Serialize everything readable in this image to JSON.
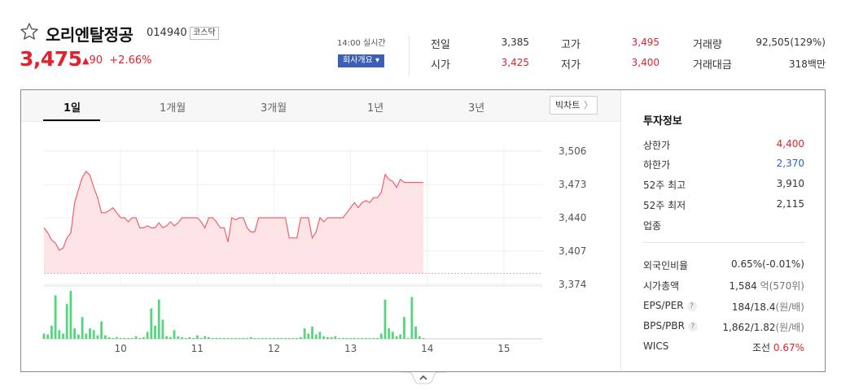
{
  "header": {
    "stock_name": "오리엔탈정공",
    "stock_code": "014940",
    "market_badge": "코스닥",
    "price": "3,475",
    "change_arrow": "▲",
    "change_amount": "90",
    "change_percent": "+2.66%",
    "time_label": "14:00 실시간",
    "company_button": "회사개요 ▾"
  },
  "quotes": {
    "prev_close": {
      "label": "전일",
      "value": "3,385"
    },
    "open": {
      "label": "시가",
      "value": "3,425"
    },
    "high": {
      "label": "고가",
      "value": "3,495"
    },
    "low": {
      "label": "저가",
      "value": "3,400"
    },
    "volume": {
      "label": "거래량",
      "value": "92,505(129%)"
    },
    "turnover": {
      "label": "거래대금",
      "value": "318백만"
    }
  },
  "tabs": [
    "1일",
    "1개월",
    "3개월",
    "1년",
    "3년"
  ],
  "active_tab": "1일",
  "big_chart_button": "빅차트",
  "invest_info": {
    "title": "투자정보",
    "upper_limit": {
      "label": "상한가",
      "value": "4,400"
    },
    "lower_limit": {
      "label": "하한가",
      "value": "2,370"
    },
    "week52_high": {
      "label": "52주 최고",
      "value": "3,910"
    },
    "week52_low": {
      "label": "52주 최저",
      "value": "2,115"
    },
    "sector": {
      "label": "업종",
      "value": ""
    },
    "foreign_ratio": {
      "label": "외국인비율",
      "value": "0.65%",
      "extra": "(-0.01%)"
    },
    "market_cap": {
      "label": "시가총액",
      "value": "1,584",
      "unit1": "억",
      "value2": "(570",
      "unit2": "위)"
    },
    "eps_per": {
      "label": "EPS/PER",
      "value": "184/18.4",
      "unit": "(원/배)"
    },
    "bps_pbr": {
      "label": "BPS/PBR",
      "value": "1,862/1.82",
      "unit": "(원/배)"
    },
    "wics": {
      "label": "WICS",
      "value": "조선",
      "extra": "0.67%"
    },
    "help_icon": "?"
  },
  "colors": {
    "up": "#e0232e",
    "down": "#2d5ddb",
    "line": "#f0606a",
    "area": "#fde4e6",
    "volume_bar": "#55d67c",
    "accent_button": "#3a5fb8"
  },
  "chart_data": {
    "type": "line",
    "y_ticks": [
      "3,506",
      "3,473",
      "3,440",
      "3,407",
      "3,374"
    ],
    "ylim": [
      3374,
      3506
    ],
    "x_ticks": [
      "10",
      "11",
      "12",
      "13",
      "14",
      "15"
    ],
    "xlim": [
      9.0,
      15.5
    ],
    "prev_close": 3385,
    "series": [
      {
        "x": [
          9.0,
          9.05,
          9.1,
          9.15,
          9.2,
          9.25,
          9.3,
          9.35,
          9.4,
          9.45,
          9.5,
          9.55,
          9.6,
          9.65,
          9.7,
          9.75,
          9.8,
          9.85,
          9.9,
          9.95,
          10.0,
          10.05,
          10.1,
          10.15,
          10.2,
          10.25,
          10.3,
          10.35,
          10.4,
          10.45,
          10.5,
          10.55,
          10.6,
          10.65,
          10.7,
          10.75,
          10.8,
          10.85,
          10.9,
          10.95,
          11.0,
          11.05,
          11.1,
          11.15,
          11.2,
          11.25,
          11.3,
          11.35,
          11.4,
          11.45,
          11.5,
          11.55,
          11.6,
          11.65,
          11.7,
          11.75,
          11.8,
          11.85,
          11.9,
          11.95,
          12.0,
          12.05,
          12.1,
          12.15,
          12.2,
          12.25,
          12.3,
          12.35,
          12.4,
          12.45,
          12.5,
          12.55,
          12.6,
          12.65,
          12.7,
          12.75,
          12.8,
          12.85,
          12.9,
          12.95,
          13.0,
          13.05,
          13.1,
          13.15,
          13.2,
          13.25,
          13.3,
          13.35,
          13.4,
          13.45,
          13.5,
          13.55,
          13.6,
          13.65,
          13.7,
          13.75,
          13.8,
          13.85,
          13.9,
          13.95
        ],
        "values": [
          3430,
          3425,
          3418,
          3415,
          3408,
          3410,
          3420,
          3425,
          3455,
          3468,
          3480,
          3486,
          3482,
          3470,
          3460,
          3445,
          3445,
          3447,
          3450,
          3445,
          3440,
          3440,
          3436,
          3440,
          3440,
          3430,
          3430,
          3432,
          3430,
          3430,
          3435,
          3430,
          3432,
          3436,
          3432,
          3435,
          3440,
          3440,
          3440,
          3440,
          3440,
          3436,
          3430,
          3440,
          3440,
          3436,
          3430,
          3430,
          3416,
          3440,
          3438,
          3440,
          3440,
          3430,
          3426,
          3426,
          3440,
          3440,
          3440,
          3440,
          3440,
          3440,
          3440,
          3440,
          3420,
          3420,
          3420,
          3440,
          3440,
          3440,
          3420,
          3426,
          3440,
          3436,
          3440,
          3440,
          3440,
          3440,
          3440,
          3445,
          3450,
          3455,
          3450,
          3455,
          3457,
          3455,
          3460,
          3460,
          3465,
          3483,
          3478,
          3476,
          3470,
          3478,
          3475,
          3475,
          3475,
          3475,
          3475,
          3475
        ]
      }
    ],
    "volume": {
      "x": [
        9.0,
        9.05,
        9.1,
        9.15,
        9.2,
        9.25,
        9.3,
        9.35,
        9.4,
        9.45,
        9.5,
        9.55,
        9.6,
        9.65,
        9.7,
        9.75,
        9.8,
        9.85,
        9.9,
        9.95,
        10.0,
        10.05,
        10.1,
        10.15,
        10.2,
        10.25,
        10.3,
        10.35,
        10.4,
        10.45,
        10.5,
        10.55,
        10.6,
        10.65,
        10.7,
        10.75,
        10.8,
        10.85,
        10.9,
        10.95,
        11.0,
        11.05,
        11.1,
        11.15,
        11.2,
        11.25,
        11.3,
        11.35,
        11.4,
        11.45,
        11.5,
        11.55,
        11.6,
        11.65,
        11.7,
        11.75,
        11.8,
        11.85,
        11.9,
        11.95,
        12.0,
        12.05,
        12.1,
        12.15,
        12.2,
        12.25,
        12.3,
        12.35,
        12.4,
        12.45,
        12.5,
        12.55,
        12.6,
        12.65,
        12.7,
        12.75,
        12.8,
        12.85,
        12.9,
        12.95,
        13.0,
        13.05,
        13.1,
        13.15,
        13.2,
        13.25,
        13.3,
        13.35,
        13.4,
        13.45,
        13.5,
        13.55,
        13.6,
        13.65,
        13.7,
        13.75,
        13.8,
        13.85,
        13.9,
        13.95
      ],
      "values": [
        6,
        5,
        15,
        50,
        10,
        6,
        40,
        55,
        12,
        5,
        25,
        6,
        12,
        10,
        4,
        20,
        4,
        2,
        1,
        2,
        1,
        1,
        1,
        1,
        3,
        1,
        2,
        8,
        35,
        15,
        45,
        22,
        3,
        2,
        10,
        3,
        2,
        1,
        2,
        1,
        4,
        1,
        3,
        2,
        1,
        1,
        1,
        1,
        1,
        1,
        1,
        1,
        1,
        1,
        2,
        1,
        1,
        1,
        1,
        1,
        1,
        1,
        1,
        1,
        1,
        1,
        1,
        2,
        12,
        6,
        14,
        5,
        8,
        3,
        2,
        2,
        3,
        1,
        1,
        1,
        1,
        1,
        1,
        1,
        1,
        1,
        1,
        1,
        6,
        45,
        12,
        8,
        3,
        5,
        25,
        1,
        48,
        14,
        3,
        1
      ]
    }
  }
}
